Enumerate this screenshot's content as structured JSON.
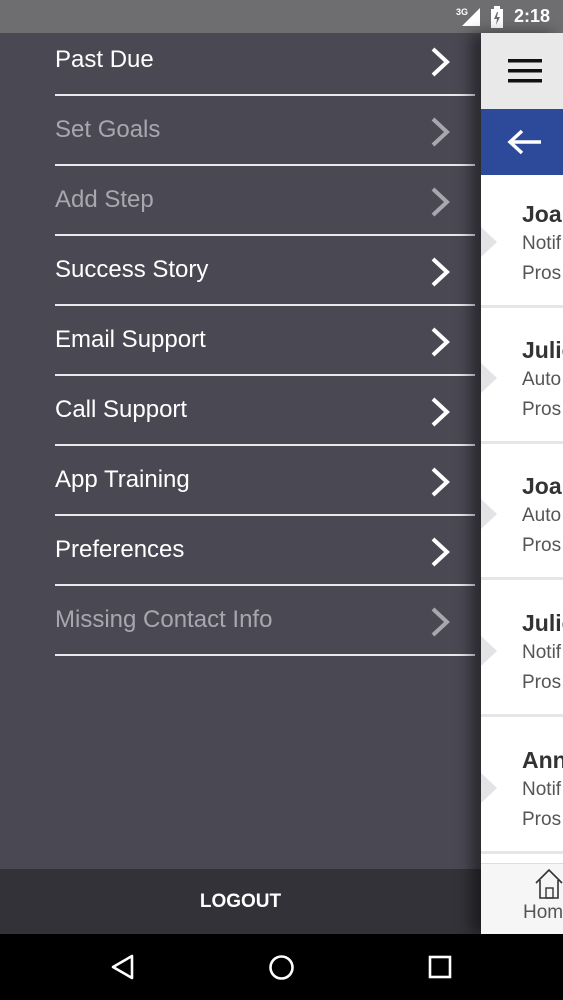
{
  "status_bar": {
    "network": "3G",
    "time": "2:18"
  },
  "drawer": {
    "items": [
      {
        "label": "Past Due",
        "dim": false
      },
      {
        "label": "Set Goals",
        "dim": true
      },
      {
        "label": "Add Step",
        "dim": true
      },
      {
        "label": "Success Story",
        "dim": false
      },
      {
        "label": "Email Support",
        "dim": false
      },
      {
        "label": "Call Support",
        "dim": false
      },
      {
        "label": "App Training",
        "dim": false
      },
      {
        "label": "Preferences",
        "dim": false
      },
      {
        "label": "Missing Contact Info",
        "dim": true
      }
    ],
    "logout_label": "LOGOUT"
  },
  "main": {
    "rows": [
      {
        "name": "Joa",
        "line2": "Notif",
        "line3": "Pros"
      },
      {
        "name": "Julie",
        "line2": "Auto",
        "line3": "Pros"
      },
      {
        "name": "Joa",
        "line2": "Auto",
        "line3": "Pros"
      },
      {
        "name": "Julie",
        "line2": "Notif",
        "line3": "Pros"
      },
      {
        "name": "Ann",
        "line2": "Notif",
        "line3": "Pros"
      }
    ],
    "tab_home_label": "Hom"
  },
  "colors": {
    "drawer_bg": "#4a4953",
    "logout_bg": "#333238",
    "accent_blue": "#2d4a9a"
  }
}
